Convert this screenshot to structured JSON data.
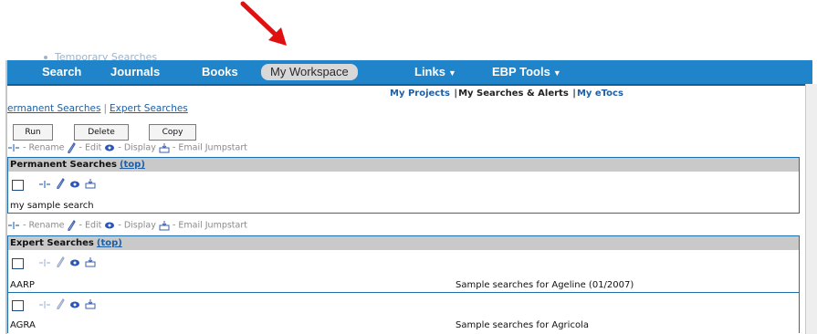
{
  "faded_item": "Temporary Searches",
  "nav": {
    "search": "Search",
    "journals": "Journals",
    "books": "Books",
    "workspace": "My Workspace",
    "links": "Links",
    "ebp": "EBP Tools"
  },
  "sub_nav": {
    "projects": "My Projects",
    "searches": "My Searches & Alerts",
    "etocs": "My eTocs"
  },
  "search_links": {
    "permanent": "ermanent Searches",
    "expert": "Expert Searches"
  },
  "buttons": {
    "run": "Run",
    "delete": "Delete",
    "copy": "Copy"
  },
  "toolbar": {
    "rename": "Rename",
    "edit": "Edit",
    "display": "Display",
    "email": "Email Jumpstart"
  },
  "permanent_panel": {
    "title": "Permanent Searches",
    "top": "(top)",
    "rows": [
      {
        "name": "my sample search",
        "desc": ""
      }
    ]
  },
  "expert_panel": {
    "title": "Expert Searches",
    "top": "(top)",
    "rows": [
      {
        "name": "AARP",
        "desc": "Sample searches for Ageline (01/2007)"
      },
      {
        "name": "AGRA",
        "desc": "Sample searches for Agricola"
      }
    ]
  },
  "colors": {
    "navbar": "#1f84c9",
    "arrow": "#e01010",
    "link": "#1f5fa3",
    "panel_border": "#1e6fa9"
  }
}
